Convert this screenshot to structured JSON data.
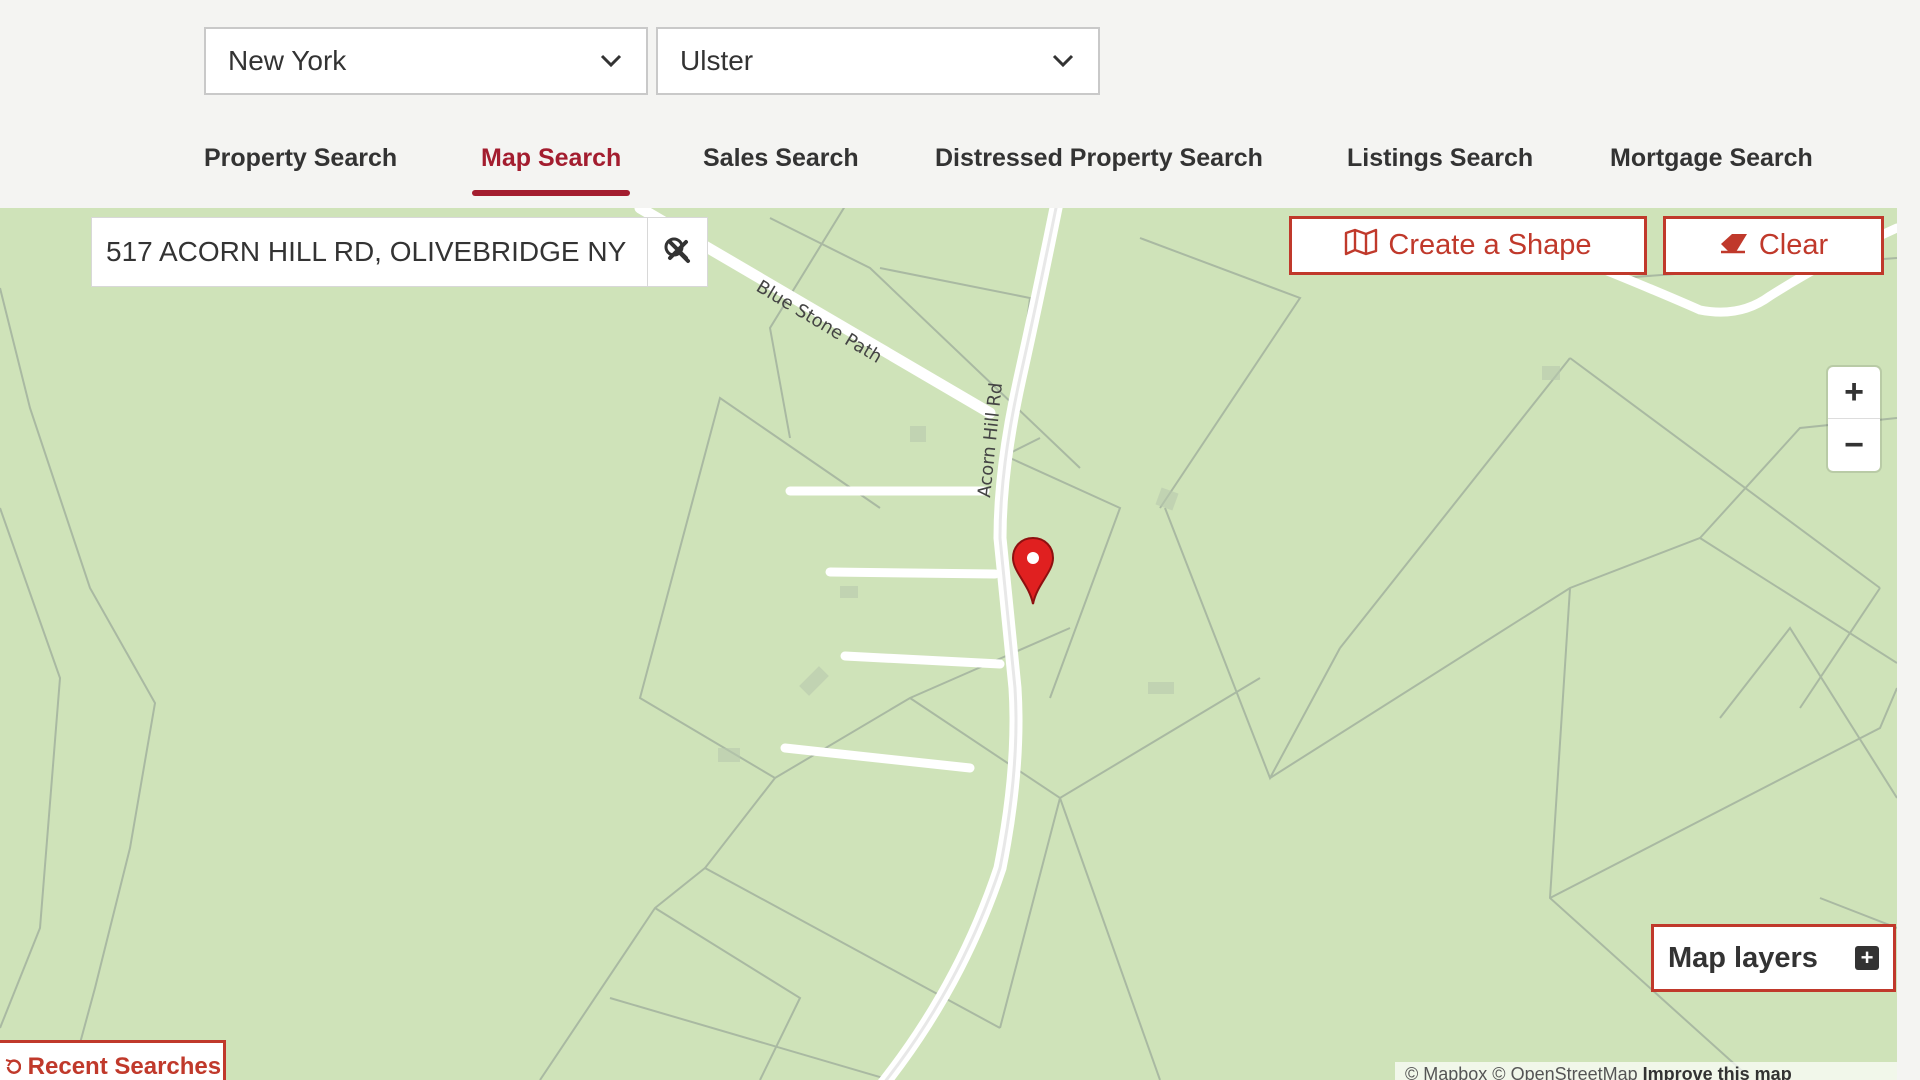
{
  "selects": {
    "state": "New York",
    "county": "Ulster"
  },
  "tabs": [
    {
      "label": "Property Search",
      "active": false
    },
    {
      "label": "Map Search",
      "active": true
    },
    {
      "label": "Sales Search",
      "active": false
    },
    {
      "label": "Distressed Property Search",
      "active": false
    },
    {
      "label": "Listings Search",
      "active": false
    },
    {
      "label": "Mortgage Search",
      "active": false
    }
  ],
  "map": {
    "search_value": "517 ACORN HILL RD, OLIVEBRIDGE NY",
    "create_shape_label": "Create a Shape",
    "clear_label": "Clear",
    "zoom_in": "+",
    "zoom_out": "−",
    "layers_label": "Map layers",
    "layers_plus": "+",
    "recent_label": "Recent Searches",
    "road_labels": {
      "blue_stone": "Blue Stone Path",
      "acorn_hill": "Acorn Hill Rd"
    },
    "attribution": {
      "prefix": "© Mapbox © OpenStreetMap",
      "link": "Improve this map"
    }
  },
  "colors": {
    "accent": "#a31d2f",
    "button_red": "#c0392b",
    "map_bg": "#cfe3b9",
    "parcel_line": "#a9b9a2",
    "pin": "#e02020"
  },
  "icons": {
    "select_chevron": "chevron-down-icon",
    "search": "search-icon",
    "clear_search": "close-icon",
    "create_shape": "map-icon",
    "clear": "eraser-icon",
    "pin": "map-pin-icon",
    "layers_expand": "plus-square-icon",
    "recent": "history-icon"
  }
}
